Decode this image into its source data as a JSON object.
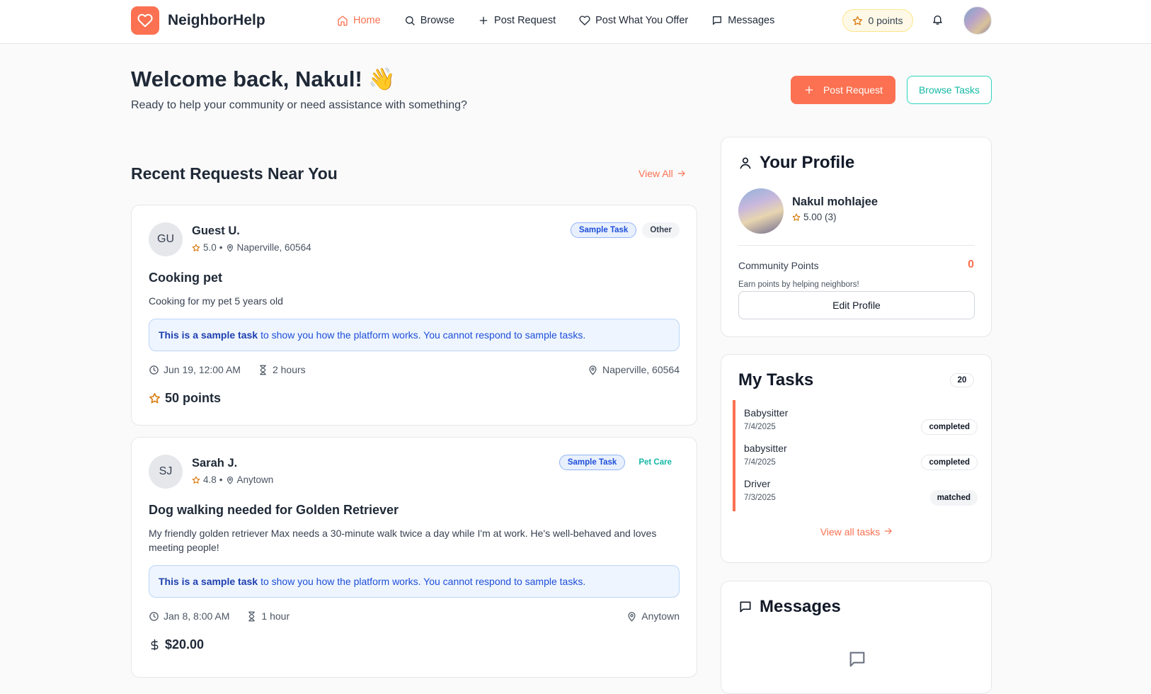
{
  "app": {
    "name": "NeighborHelp"
  },
  "nav": {
    "items": [
      {
        "label": "Home",
        "icon": "home-icon",
        "active": true
      },
      {
        "label": "Browse",
        "icon": "search-icon"
      },
      {
        "label": "Post Request",
        "icon": "plus-icon"
      },
      {
        "label": "Post What You Offer",
        "icon": "heart-icon"
      },
      {
        "label": "Messages",
        "icon": "message-icon"
      }
    ],
    "points": "0 points"
  },
  "welcome": {
    "title": "Welcome back, Nakul! 👋",
    "subtitle": "Ready to help your community or need assistance with something?",
    "post_request": "Post Request",
    "browse_tasks": "Browse Tasks"
  },
  "recent": {
    "title": "Recent Requests Near You",
    "view_all": "View All",
    "cards": [
      {
        "initials": "GU",
        "name": "Guest U.",
        "rating": "5.0",
        "location": "Naperville, 60564",
        "badges": [
          "Sample Task",
          "Other"
        ],
        "title": "Cooking pet",
        "description": "Cooking for my pet 5 years old",
        "sample_bold": "This is a sample task",
        "sample_text": "to show you how the platform works. You cannot respond to sample tasks.",
        "date": "Jun 19, 12:00 AM",
        "duration": "2 hours",
        "place": "Naperville, 60564",
        "reward": "50 points",
        "reward_icon": "star-icon"
      },
      {
        "initials": "SJ",
        "name": "Sarah J.",
        "rating": "4.8",
        "location": "Anytown",
        "badges": [
          "Sample Task",
          "Pet Care"
        ],
        "title": "Dog walking needed for Golden Retriever",
        "description": "My friendly golden retriever Max needs a 30-minute walk twice a day while I'm at work. He's well-behaved and loves meeting people!",
        "sample_bold": "This is a sample task",
        "sample_text": "to show you how the platform works. You cannot respond to sample tasks.",
        "date": "Jan 8, 8:00 AM",
        "duration": "1 hour",
        "place": "Anytown",
        "reward": "$20.00",
        "reward_icon": "dollar-icon"
      }
    ]
  },
  "profile": {
    "title": "Your Profile",
    "name": "Nakul mohlajee",
    "rating": "5.00 (3)",
    "points_label": "Community Points",
    "points_value": "0",
    "points_hint": "Earn points by helping neighbors!",
    "edit": "Edit Profile"
  },
  "my_tasks": {
    "title": "My Tasks",
    "count": "20",
    "items": [
      {
        "name": "Babysitter",
        "date": "7/4/2025",
        "status": "completed"
      },
      {
        "name": "babysitter",
        "date": "7/4/2025",
        "status": "completed"
      },
      {
        "name": "Driver",
        "date": "7/3/2025",
        "status": "matched"
      }
    ],
    "view_all": "View all tasks"
  },
  "messages": {
    "title": "Messages"
  },
  "colors": {
    "accent": "#fb7151",
    "teal": "#14b8a6",
    "sample_blue": "#1d4ed8"
  }
}
